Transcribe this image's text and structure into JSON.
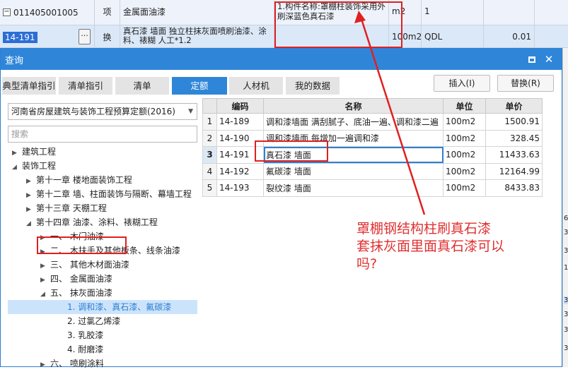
{
  "sheet": {
    "row1": {
      "code": "011405001005",
      "type": "项",
      "name": "金属面油漆",
      "feature": "1.构件名称:罩棚柱装饰采用外刷深蓝色真石漆",
      "unit": "m2",
      "qty": "1"
    },
    "row2": {
      "code": "14-191",
      "type": "换",
      "name": "真石漆 墙面 独立柱抹灰面喷刷油漆、涂料、裱糊 人工*1.2",
      "unit": "100m2",
      "qty": "QDL",
      "val": "0.01"
    }
  },
  "dialog": {
    "title": "查询",
    "tabs": [
      "典型清单指引",
      "清单指引",
      "清单",
      "定额",
      "人材机",
      "我的数据"
    ],
    "active_tab": "定额",
    "insert_label": "插入(I)",
    "replace_label": "替换(R)",
    "quota_select": "河南省房屋建筑与装饰工程预算定额(2016)",
    "search_placeholder": "搜索"
  },
  "tree": [
    {
      "label": "建筑工程",
      "state": "collapsed"
    },
    {
      "label": "装饰工程",
      "state": "expanded"
    },
    {
      "label": "第十一章 楼地面装饰工程",
      "state": "collapsed"
    },
    {
      "label": "第十二章 墙、柱面装饰与隔断、幕墙工程",
      "state": "collapsed"
    },
    {
      "label": "第十三章 天棚工程",
      "state": "collapsed"
    },
    {
      "label": "第十四章 油漆、涂料、裱糊工程",
      "state": "expanded"
    },
    {
      "label": "一、 木门油漆",
      "state": "collapsed"
    },
    {
      "label": "二、 木扶手及其他板条、线条油漆",
      "state": "collapsed"
    },
    {
      "label": "三、 其他木材面油漆",
      "state": "collapsed"
    },
    {
      "label": "四、 金属面油漆",
      "state": "collapsed"
    },
    {
      "label": "五、 抹灰面油漆",
      "state": "expanded"
    },
    {
      "label": "1. 调和漆、真石漆、氟碳漆",
      "state": "leaf-selected"
    },
    {
      "label": "2. 过氯乙烯漆",
      "state": "leaf"
    },
    {
      "label": "3. 乳胶漆",
      "state": "leaf"
    },
    {
      "label": "4. 耐磨漆",
      "state": "leaf"
    },
    {
      "label": "六、 喷刷涂料",
      "state": "collapsed"
    }
  ],
  "grid": {
    "headers": [
      "",
      "编码",
      "名称",
      "单位",
      "单价"
    ],
    "rows": [
      {
        "n": "1",
        "code": "14-189",
        "name": "调和漆墙面 满刮腻子、底油一遍、调和漆二遍",
        "unit": "100m2",
        "price": "1500.91"
      },
      {
        "n": "2",
        "code": "14-190",
        "name": "调和漆墙面 每增加一遍调和漆",
        "unit": "100m2",
        "price": "328.45"
      },
      {
        "n": "3",
        "code": "14-191",
        "name": "真石漆 墙面",
        "unit": "100m2",
        "price": "11433.63"
      },
      {
        "n": "4",
        "code": "14-192",
        "name": "氟碳漆 墙面",
        "unit": "100m2",
        "price": "12164.99"
      },
      {
        "n": "5",
        "code": "14-193",
        "name": "裂纹漆 墙面",
        "unit": "100m2",
        "price": "8433.83"
      }
    ]
  },
  "annotation": {
    "line1": "罩棚钢结构柱刷真石漆",
    "line2": "套抹灰面里面真石漆可以",
    "line3": "吗?"
  },
  "edge_numbers": [
    "6.",
    "3.",
    "33",
    "1.",
    "31",
    "3.",
    "3.",
    "3."
  ],
  "colors": {
    "accent": "#2f86d9",
    "annotation": "#e02020"
  }
}
